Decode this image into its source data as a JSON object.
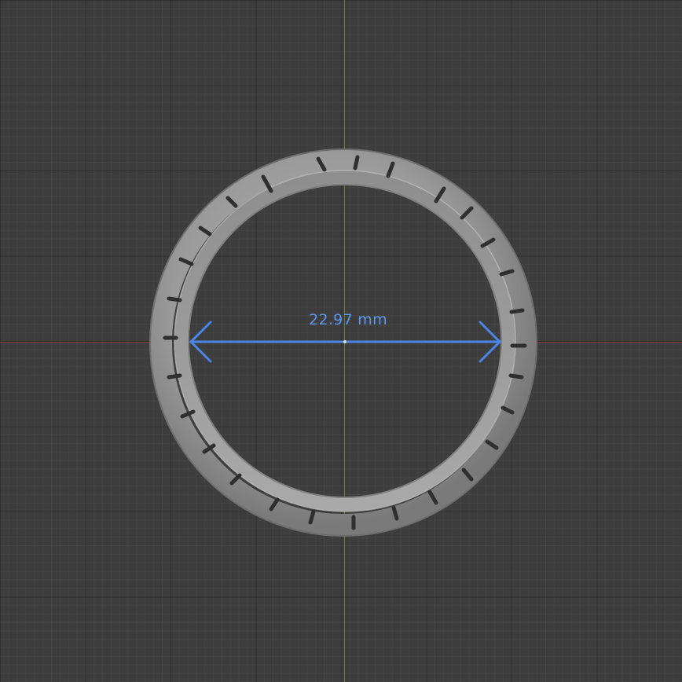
{
  "viewport": {
    "background_color": "#3d3d3d",
    "x_axis_color": "#8b3b3b",
    "y_axis_color": "#5f7f34"
  },
  "model": {
    "name": "ring",
    "color": "#9a9a9a"
  },
  "measurement": {
    "label": "22.97 mm",
    "color": "#4a86e8"
  }
}
